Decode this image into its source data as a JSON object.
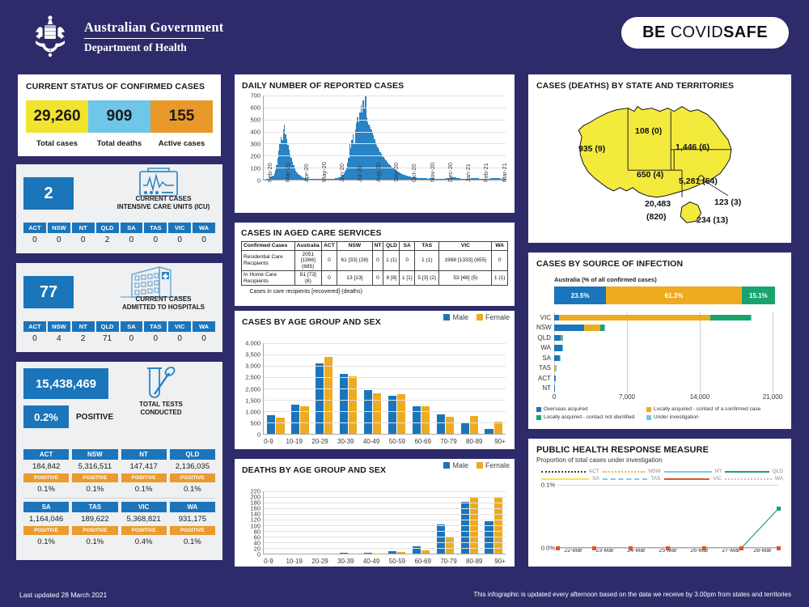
{
  "header": {
    "gov_line1": "Australian Government",
    "gov_line2": "Department of Health",
    "covidsafe_be": "BE ",
    "covidsafe_covid": "COVID",
    "covidsafe_safe": "SAFE"
  },
  "colors": {
    "navy": "#2e2b6b",
    "blue": "#1b75bb",
    "chart_blue": "#2a83c4",
    "yellow": "#f2e32e",
    "lightblue": "#6ec6e8",
    "orange": "#e8992a",
    "gold": "#eeab20",
    "green": "#1aa36f",
    "map_yellow": "#f4ea3c"
  },
  "status": {
    "title": "CURRENT STATUS OF CONFIRMED CASES",
    "kpis": [
      {
        "value": "29,260",
        "label": "Total cases",
        "color": "#f2e32e"
      },
      {
        "value": "909",
        "label": "Total deaths",
        "color": "#6ec6e8"
      },
      {
        "value": "155",
        "label": "Active cases",
        "color": "#e8992a"
      }
    ]
  },
  "icu": {
    "value": "2",
    "caption_line1": "CURRENT CASES",
    "caption_line2": "INTENSIVE CARE UNITS (ICU)",
    "icon": "heart-monitor-icon",
    "states": [
      "ACT",
      "NSW",
      "NT",
      "QLD",
      "SA",
      "TAS",
      "VIC",
      "WA"
    ],
    "values": [
      "0",
      "0",
      "0",
      "2",
      "0",
      "0",
      "0",
      "0"
    ]
  },
  "hospital": {
    "value": "77",
    "caption_line1": "CURRENT CASES",
    "caption_line2": "ADMITTED TO HOSPITALS",
    "icon": "hospital-building-icon",
    "states": [
      "ACT",
      "NSW",
      "NT",
      "QLD",
      "SA",
      "TAS",
      "VIC",
      "WA"
    ],
    "values": [
      "0",
      "4",
      "2",
      "71",
      "0",
      "0",
      "0",
      "0"
    ]
  },
  "tests": {
    "value": "15,438,469",
    "positive_pct": "0.2%",
    "positive_label": "POSITIVE",
    "caption_line1": "TOTAL TESTS",
    "caption_line2": "CONDUCTED",
    "icon": "test-tube-swab-icon",
    "positive_tag": "POSITIVE",
    "rows": [
      [
        {
          "state": "ACT",
          "tests": "184,842",
          "pct": "0.1%"
        },
        {
          "state": "NSW",
          "tests": "5,316,511",
          "pct": "0.1%"
        },
        {
          "state": "NT",
          "tests": "147,417",
          "pct": "0.1%"
        },
        {
          "state": "QLD",
          "tests": "2,136,035",
          "pct": "0.1%"
        }
      ],
      [
        {
          "state": "SA",
          "tests": "1,164,046",
          "pct": "0.1%"
        },
        {
          "state": "TAS",
          "tests": "189,622",
          "pct": "0.1%"
        },
        {
          "state": "VIC",
          "tests": "5,368,821",
          "pct": "0.4%"
        },
        {
          "state": "WA",
          "tests": "931,175",
          "pct": "0.1%"
        }
      ]
    ]
  },
  "aged_care": {
    "title": "CASES IN AGED CARE SERVICES",
    "columns": [
      "Confirmed Cases",
      "Australia",
      "ACT",
      "NSW",
      "NT",
      "QLD",
      "SA",
      "TAS",
      "VIC",
      "WA"
    ],
    "rows": [
      {
        "label": "Residential Care Recipients",
        "cells": [
          "2051 [1366] (685)",
          "0",
          "61 [33] (28)",
          "0",
          "1 (1)",
          "0",
          "1 (1)",
          "1988 [1333] (655)",
          "0"
        ]
      },
      {
        "label": "In Home Care Recipients",
        "cells": [
          "81 [73] (8)",
          "0",
          "13 [13]",
          "0",
          "8 [8]",
          "1 [1]",
          "5 [3] (2)",
          "53 [48] (5)",
          "1 (1)"
        ]
      }
    ],
    "note": "Cases in care recipients [recovered] (deaths)"
  },
  "map": {
    "title": "CASES (DEATHS) BY STATE AND TERRITORIES",
    "labels": [
      {
        "state": "WA",
        "text": "935 (9)"
      },
      {
        "state": "NT",
        "text": "108 (0)"
      },
      {
        "state": "QLD",
        "text": "1,446 (6)"
      },
      {
        "state": "SA",
        "text": "650 (4)"
      },
      {
        "state": "NSW",
        "text": "5,281 (54)"
      },
      {
        "state": "VIC",
        "text": "20,483"
      },
      {
        "state": "VIC2",
        "text": "(820)"
      },
      {
        "state": "ACT",
        "text": "123 (3)"
      },
      {
        "state": "TAS",
        "text": "234 (13)"
      }
    ]
  },
  "footer": {
    "left": "Last updated 28 March 2021",
    "right": "This infographic is updated every afternoon based on the data we receive by 3.00pm from states and territories"
  },
  "chart_data": [
    {
      "id": "daily_cases",
      "type": "bar",
      "title": "DAILY NUMBER OF REPORTED CASES",
      "xlabel": "",
      "ylabel": "",
      "ylim": [
        0,
        700
      ],
      "yticks": [
        0,
        100,
        200,
        300,
        400,
        500,
        600,
        700
      ],
      "grid": true,
      "categories": [
        "Feb-20",
        "Mar-20",
        "Apr-20",
        "May-20",
        "Jun-20",
        "Jul-20",
        "Aug-20",
        "Sep-20",
        "Oct-20",
        "Nov-20",
        "Dec-20",
        "Jan-21",
        "Feb-21",
        "Mar-21"
      ],
      "values": [
        2,
        3,
        4,
        6,
        8,
        12,
        18,
        25,
        35,
        55,
        80,
        120,
        180,
        240,
        300,
        355,
        330,
        420,
        460,
        380,
        340,
        290,
        250,
        210,
        180,
        150,
        120,
        95,
        75,
        60,
        48,
        40,
        32,
        26,
        20,
        16,
        14,
        12,
        10,
        9,
        8,
        8,
        7,
        7,
        8,
        9,
        10,
        9,
        8,
        7,
        7,
        6,
        6,
        7,
        8,
        8,
        7,
        6,
        6,
        7,
        8,
        9,
        10,
        12,
        14,
        16,
        18,
        22,
        26,
        30,
        40,
        55,
        75,
        100,
        140,
        180,
        300,
        260,
        330,
        380,
        300,
        420,
        470,
        520,
        480,
        560,
        620,
        560,
        660,
        600,
        700,
        520,
        480,
        460,
        440,
        420,
        400,
        370,
        340,
        310,
        290,
        270,
        250,
        230,
        215,
        200,
        190,
        175,
        160,
        150,
        140,
        130,
        120,
        110,
        100,
        92,
        85,
        78,
        72,
        66,
        60,
        55,
        50,
        46,
        42,
        38,
        35,
        32,
        29,
        27,
        25,
        23,
        21,
        20,
        18,
        17,
        16,
        15,
        14,
        13,
        13,
        12,
        12,
        11,
        11,
        10,
        10,
        12,
        14,
        13,
        12,
        11,
        10,
        10,
        9,
        9,
        8,
        8,
        8,
        8,
        9,
        10,
        11,
        12,
        14,
        16,
        18,
        20,
        22,
        20,
        18,
        16,
        14,
        12,
        11,
        10,
        10,
        9,
        9,
        8,
        8,
        8,
        9,
        10,
        11,
        12,
        13,
        14,
        13,
        12,
        11,
        10,
        10,
        9,
        9,
        8,
        8,
        8,
        8,
        9,
        10,
        11,
        12,
        13,
        14,
        15,
        14,
        13,
        12,
        11,
        10,
        10,
        9,
        9,
        8,
        8
      ]
    },
    {
      "id": "cases_by_age_sex",
      "type": "bar",
      "title": "CASES BY AGE GROUP AND SEX",
      "xlabel": "",
      "ylabel": "",
      "ylim": [
        0,
        4000
      ],
      "yticks": [
        "0",
        "500",
        "1,000",
        "1,500",
        "2,000",
        "2,500",
        "3,000",
        "3,500",
        "4,000"
      ],
      "grid": true,
      "legend": [
        "Male",
        "Female"
      ],
      "legend_position": "top-right",
      "categories": [
        "0-9",
        "10-19",
        "20-29",
        "30-39",
        "40-49",
        "50-59",
        "60-69",
        "70-79",
        "80-89",
        "90+"
      ],
      "series": [
        {
          "name": "Male",
          "color": "#1b75bb",
          "values": [
            810,
            1270,
            3115,
            2650,
            1945,
            1680,
            1225,
            865,
            495,
            230
          ]
        },
        {
          "name": "Female",
          "color": "#eeab20",
          "values": [
            725,
            1210,
            3410,
            2540,
            1800,
            1755,
            1230,
            750,
            775,
            545
          ]
        }
      ]
    },
    {
      "id": "deaths_by_age_sex",
      "type": "bar",
      "title": "DEATHS BY AGE GROUP AND SEX",
      "xlabel": "",
      "ylabel": "",
      "ylim": [
        0,
        220
      ],
      "yticks": [
        "0",
        "20",
        "40",
        "60",
        "80",
        "100",
        "120",
        "140",
        "160",
        "180",
        "200",
        "220"
      ],
      "grid": true,
      "legend": [
        "Male",
        "Female"
      ],
      "legend_position": "top-right",
      "categories": [
        "0-9",
        "10-19",
        "20-29",
        "30-39",
        "40-49",
        "50-59",
        "60-69",
        "70-79",
        "80-89",
        "90+"
      ],
      "series": [
        {
          "name": "Male",
          "color": "#1b75bb",
          "values": [
            0,
            0,
            0,
            2,
            2,
            10,
            25,
            102,
            182,
            115
          ]
        },
        {
          "name": "Female",
          "color": "#eeab20",
          "values": [
            0,
            0,
            0,
            0,
            1,
            5,
            12,
            56,
            196,
            200
          ]
        }
      ]
    },
    {
      "id": "cases_by_source",
      "type": "bar",
      "title": "CASES BY SOURCE OF INFECTION",
      "subtitle": "Australia (% of all confirmed cases)",
      "orientation": "horizontal",
      "stacked": true,
      "xlim": [
        0,
        21000
      ],
      "xticks": [
        "0",
        "7,000",
        "14,000",
        "21,000"
      ],
      "grid": true,
      "legend_position": "bottom",
      "legend": [
        {
          "name": "Overseas acquired",
          "color": "#1b75bb"
        },
        {
          "name": "Locally acquired - contact of a confirmed case",
          "color": "#eeab20"
        },
        {
          "name": "Locally acquired - contact not identified",
          "color": "#1aa36f"
        },
        {
          "name": "Under investigation",
          "color": "#6ec6e8"
        }
      ],
      "australia_summary": [
        {
          "label": "23.5%",
          "value": 23.5,
          "color": "#1b75bb"
        },
        {
          "label": "61.3%",
          "value": 61.3,
          "color": "#eeab20"
        },
        {
          "label": "15.1%",
          "value": 15.1,
          "color": "#1aa36f"
        }
      ],
      "categories": [
        "VIC",
        "NSW",
        "QLD",
        "WA",
        "SA",
        "TAS",
        "ACT",
        "NT"
      ],
      "series": [
        {
          "name": "Overseas acquired",
          "color": "#1b75bb",
          "values": [
            520,
            3090,
            670,
            830,
            470,
            20,
            90,
            100
          ]
        },
        {
          "name": "Locally acquired - contact of a confirmed case",
          "color": "#eeab20",
          "values": [
            15700,
            1700,
            110,
            0,
            20,
            180,
            20,
            0
          ]
        },
        {
          "name": "Locally acquired - contact not identified",
          "color": "#1aa36f",
          "values": [
            4200,
            400,
            30,
            10,
            120,
            10,
            10,
            0
          ]
        },
        {
          "name": "Under investigation",
          "color": "#6ec6e8",
          "values": [
            60,
            90,
            10,
            10,
            10,
            5,
            5,
            5
          ]
        }
      ]
    },
    {
      "id": "public_health_response",
      "type": "line",
      "title": "PUBLIC HEALTH RESPONSE MEASURE",
      "subtitle": "Proportion of total cases under investigation",
      "ylim": [
        0,
        0.1
      ],
      "yticks": [
        "0.0%",
        "0.1%"
      ],
      "grid": true,
      "legend_position": "top",
      "x": [
        "22-Mar",
        "23-Mar",
        "24-Mar",
        "25-Mar",
        "26-Mar",
        "27-Mar",
        "28-Mar"
      ],
      "series": [
        {
          "name": "ACT",
          "color": "#3b3b3b",
          "style": "dotted",
          "values": [
            0,
            0,
            0,
            0,
            0,
            0,
            0
          ]
        },
        {
          "name": "NSW",
          "color": "#e8b93a",
          "style": "dotted",
          "values": [
            0,
            0,
            0,
            0,
            0,
            0,
            0
          ]
        },
        {
          "name": "NT",
          "color": "#7fc8ea",
          "style": "solid",
          "values": [
            0,
            0,
            0,
            0,
            0,
            0,
            0
          ]
        },
        {
          "name": "QLD",
          "color": "#1aa36f",
          "style": "solid",
          "values": [
            0,
            0,
            0,
            0,
            0,
            0,
            0.062
          ]
        },
        {
          "name": "SA",
          "color": "#f5e54a",
          "style": "solid",
          "values": [
            0,
            0,
            0,
            0,
            0,
            0,
            0
          ]
        },
        {
          "name": "TAS",
          "color": "#7fc8ea",
          "style": "dashed",
          "values": [
            0,
            0,
            0,
            0,
            0,
            0,
            0
          ]
        },
        {
          "name": "VIC",
          "color": "#d9591f",
          "style": "solid",
          "values": [
            0,
            0,
            0,
            0,
            0,
            0,
            0
          ]
        },
        {
          "name": "WA",
          "color": "#d8b7d8",
          "style": "dotted",
          "values": [
            0,
            0,
            0,
            0,
            0,
            0,
            0
          ]
        }
      ]
    }
  ]
}
